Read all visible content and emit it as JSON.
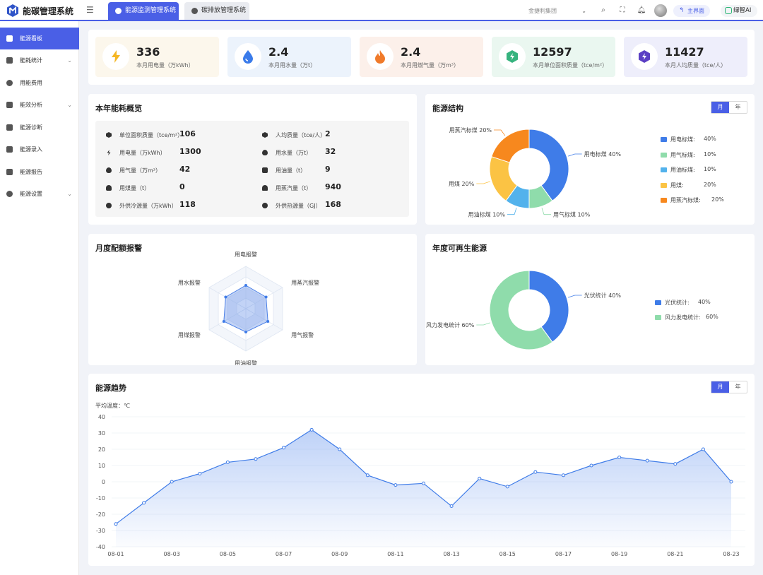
{
  "header": {
    "app_title": "能碳管理系统",
    "tabs": [
      {
        "label": "能源监测管理系统"
      },
      {
        "label": "碳排放管理系统"
      }
    ],
    "org_select": "金捷利集团",
    "home_label": "主界面",
    "brand_label": "绿智AI"
  },
  "sidebar": {
    "items": [
      {
        "label": "能源看板",
        "active": true
      },
      {
        "label": "能耗统计",
        "has_children": true
      },
      {
        "label": "用能费用"
      },
      {
        "label": "能效分析",
        "has_children": true
      },
      {
        "label": "能源诊断"
      },
      {
        "label": "能源录入"
      },
      {
        "label": "能源报告"
      },
      {
        "label": "能源设置",
        "has_children": true
      }
    ]
  },
  "stats": [
    {
      "value": "336",
      "label": "本月用电量（万kWh）",
      "icon": "lightning-icon",
      "color": "#f5b622",
      "bg": "#fcf7ec"
    },
    {
      "value": "2.4",
      "label": "本月用水量（万t）",
      "icon": "water-drop-icon",
      "color": "#3a7bea",
      "bg": "#ecf3fc"
    },
    {
      "value": "2.4",
      "label": "本月用燃气量（万m³）",
      "icon": "flame-icon",
      "color": "#f07a2a",
      "bg": "#fcf0ea"
    },
    {
      "value": "12597",
      "label": "本月单位面积质量（tce/m²）",
      "icon": "hexagon-bolt-icon",
      "color": "#36b37e",
      "bg": "#eaf7f0"
    },
    {
      "value": "11427",
      "label": "本月人均质量（tce/人）",
      "icon": "hexagon-bolt-icon",
      "color": "#5b3fc4",
      "bg": "#eeeefb"
    }
  ],
  "overview": {
    "title": "本年能耗概览",
    "left": [
      {
        "label": "单位面积质量（tce/m²）",
        "value": "106",
        "icon": "hexagon-icon"
      },
      {
        "label": "用电量（万kWh）",
        "value": "1300",
        "icon": "lightning-icon"
      },
      {
        "label": "用气量（万m³）",
        "value": "42",
        "icon": "flame-icon"
      },
      {
        "label": "用煤量（t）",
        "value": "0",
        "icon": "coal-icon"
      },
      {
        "label": "外供冷源量（万kWh）",
        "value": "118",
        "icon": "snowflake-icon"
      }
    ],
    "right": [
      {
        "label": "人均质量（tce/人）",
        "value": "2",
        "icon": "hexagon-icon"
      },
      {
        "label": "用水量（万t）",
        "value": "32",
        "icon": "water-drop-icon"
      },
      {
        "label": "用油量（t）",
        "value": "9",
        "icon": "oil-can-icon"
      },
      {
        "label": "用蒸汽量（t）",
        "value": "940",
        "icon": "steam-icon"
      },
      {
        "label": "外供热源量（GJ）",
        "value": "168",
        "icon": "heat-icon"
      }
    ]
  },
  "structure": {
    "title": "能源结构",
    "toggle": {
      "month": "月",
      "year": "年"
    },
    "chart_data": {
      "type": "pie",
      "slices": [
        {
          "name": "用电标煤",
          "value": 40,
          "color": "#3f7ce8",
          "label": "用电标煤 40%",
          "legend": "用电标煤:",
          "pct": "40%"
        },
        {
          "name": "用气标煤",
          "value": 10,
          "color": "#8fdcab",
          "label": "用气标煤 10%",
          "legend": "用气标煤:",
          "pct": "10%"
        },
        {
          "name": "用油标煤",
          "value": 10,
          "color": "#52b2ec",
          "label": "用油标煤 10%",
          "legend": "用油标煤:",
          "pct": "10%"
        },
        {
          "name": "用煤",
          "value": 20,
          "color": "#fbc344",
          "label": "用煤 20%",
          "legend": "用煤:",
          "pct": "20%"
        },
        {
          "name": "用蒸汽标煤",
          "value": 20,
          "color": "#f7881e",
          "label": "用蒸汽标煤 20%",
          "legend": "用蒸汽标煤:",
          "pct": "20%"
        }
      ]
    }
  },
  "quota": {
    "title": "月度配额报警",
    "chart_data": {
      "type": "radar",
      "axes": [
        "用电报警",
        "用蒸汽报警",
        "用气报警",
        "用油报警",
        "用煤报警",
        "用水报警"
      ],
      "values": [
        0.55,
        0.55,
        0.6,
        0.55,
        0.6,
        0.55
      ]
    }
  },
  "renewable": {
    "title": "年度可再生能源",
    "chart_data": {
      "type": "pie",
      "slices": [
        {
          "name": "光伏统计",
          "value": 40,
          "color": "#3f7ce8",
          "label": "光伏统计 40%",
          "legend": "光伏统计:",
          "pct": "40%"
        },
        {
          "name": "风力发电统计",
          "value": 60,
          "color": "#8fdcab",
          "label": "风力发电统计 60%",
          "legend": "风力发电统计:",
          "pct": "60%"
        }
      ]
    }
  },
  "trend": {
    "title": "能源趋势",
    "toggle": {
      "month": "月",
      "year": "年"
    },
    "chart_data": {
      "type": "area",
      "ylabel": "平均温度：℃",
      "ylim": [
        -40,
        40
      ],
      "yticks": [
        40,
        30,
        20,
        10,
        0,
        -10,
        -20,
        -30,
        -40
      ],
      "x": [
        "08-01",
        "08-02",
        "08-03",
        "08-04",
        "08-05",
        "08-06",
        "08-07",
        "08-08",
        "08-09",
        "08-10",
        "08-11",
        "08-12",
        "08-13",
        "08-14",
        "08-15",
        "08-16",
        "08-17",
        "08-18",
        "08-19",
        "08-20",
        "08-21",
        "08-22",
        "08-23"
      ],
      "xticks": [
        "08-01",
        "08-03",
        "08-05",
        "08-07",
        "08-09",
        "08-11",
        "08-13",
        "08-15",
        "08-17",
        "08-19",
        "08-21",
        "08-23"
      ],
      "values": [
        -26,
        -13,
        0,
        5,
        12,
        14,
        21,
        32,
        20,
        4,
        -2,
        -1,
        -15,
        2,
        -3,
        6,
        4,
        10,
        15,
        13,
        11,
        20,
        0
      ],
      "color": "#3f7ce8"
    }
  }
}
